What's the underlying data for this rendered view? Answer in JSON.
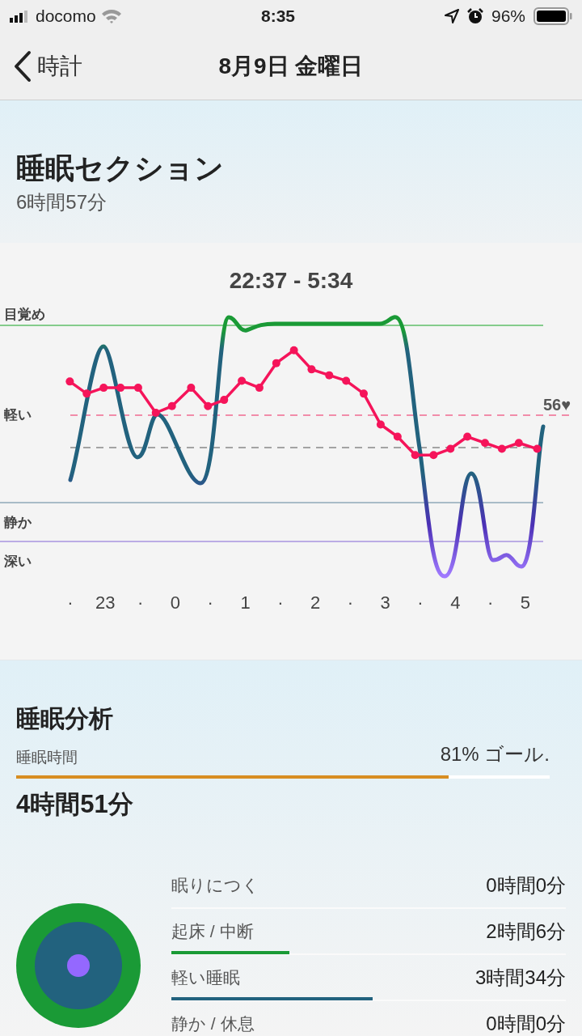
{
  "status_bar": {
    "carrier": "docomo",
    "time": "8:35",
    "battery": "96%"
  },
  "nav": {
    "back": "時計",
    "title": "8月9日 金曜日"
  },
  "header": {
    "title": "睡眠セクション",
    "subtitle": "6時間57分"
  },
  "sleep_chart": {
    "range": "22:37 - 5:34",
    "stages": [
      "目覚め",
      "軽い",
      "静か",
      "深い"
    ],
    "heart_rate": "56♥",
    "x_labels": [
      "·",
      "23",
      "·",
      "0",
      "·",
      "1",
      "·",
      "2",
      "·",
      "3",
      "·",
      "4",
      "·",
      "5"
    ]
  },
  "analysis": {
    "title": "睡眠分析",
    "label": "睡眠時間",
    "goal": "81% ゴール.",
    "level": 0.81,
    "total": "4時間51分",
    "stages": [
      {
        "name": "眠りにつく",
        "value": "0時間0分"
      },
      {
        "name": "起床 / 中断",
        "value": "2時間6分",
        "level": 0.3,
        "color": "#1a9a36"
      },
      {
        "name": "軽い睡眠",
        "value": "3時間34分",
        "level": 0.51,
        "color": "#22627e"
      },
      {
        "name": "静か / 休息",
        "value": "0時間0分"
      }
    ]
  }
}
